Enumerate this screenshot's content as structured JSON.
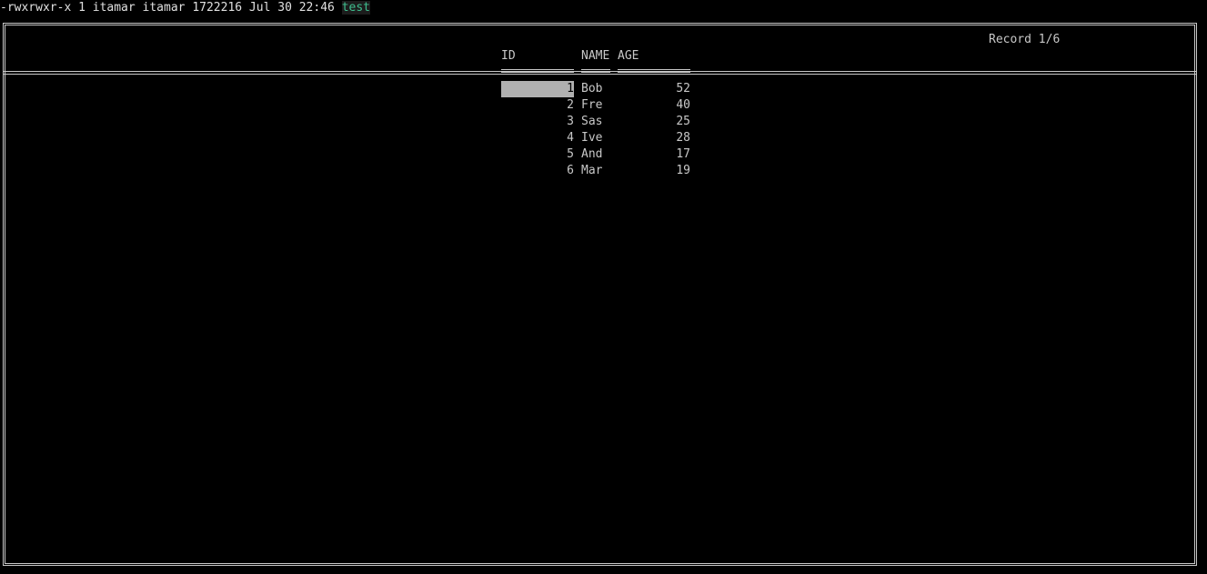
{
  "terminal": {
    "prefix": "-rwxrwxr-x 1 itamar itamar 1722216 Jul 30 22:46 ",
    "filename": "test"
  },
  "viewer": {
    "record_counter": "Record 1/6",
    "columns": [
      "ID",
      "NAME",
      "AGE"
    ],
    "selected_row": 0,
    "rows": [
      {
        "id": "1",
        "name": "Bob",
        "age": "52"
      },
      {
        "id": "2",
        "name": "Fre",
        "age": "40"
      },
      {
        "id": "3",
        "name": "Sas",
        "age": "25"
      },
      {
        "id": "4",
        "name": "Ive",
        "age": "28"
      },
      {
        "id": "5",
        "name": "And",
        "age": "17"
      },
      {
        "id": "6",
        "name": "Mar",
        "age": "19"
      }
    ]
  },
  "colors": {
    "background": "#000000",
    "text": "#c8c8c8",
    "filename": "#3fbf8f",
    "selection": "#b0b0b0"
  }
}
